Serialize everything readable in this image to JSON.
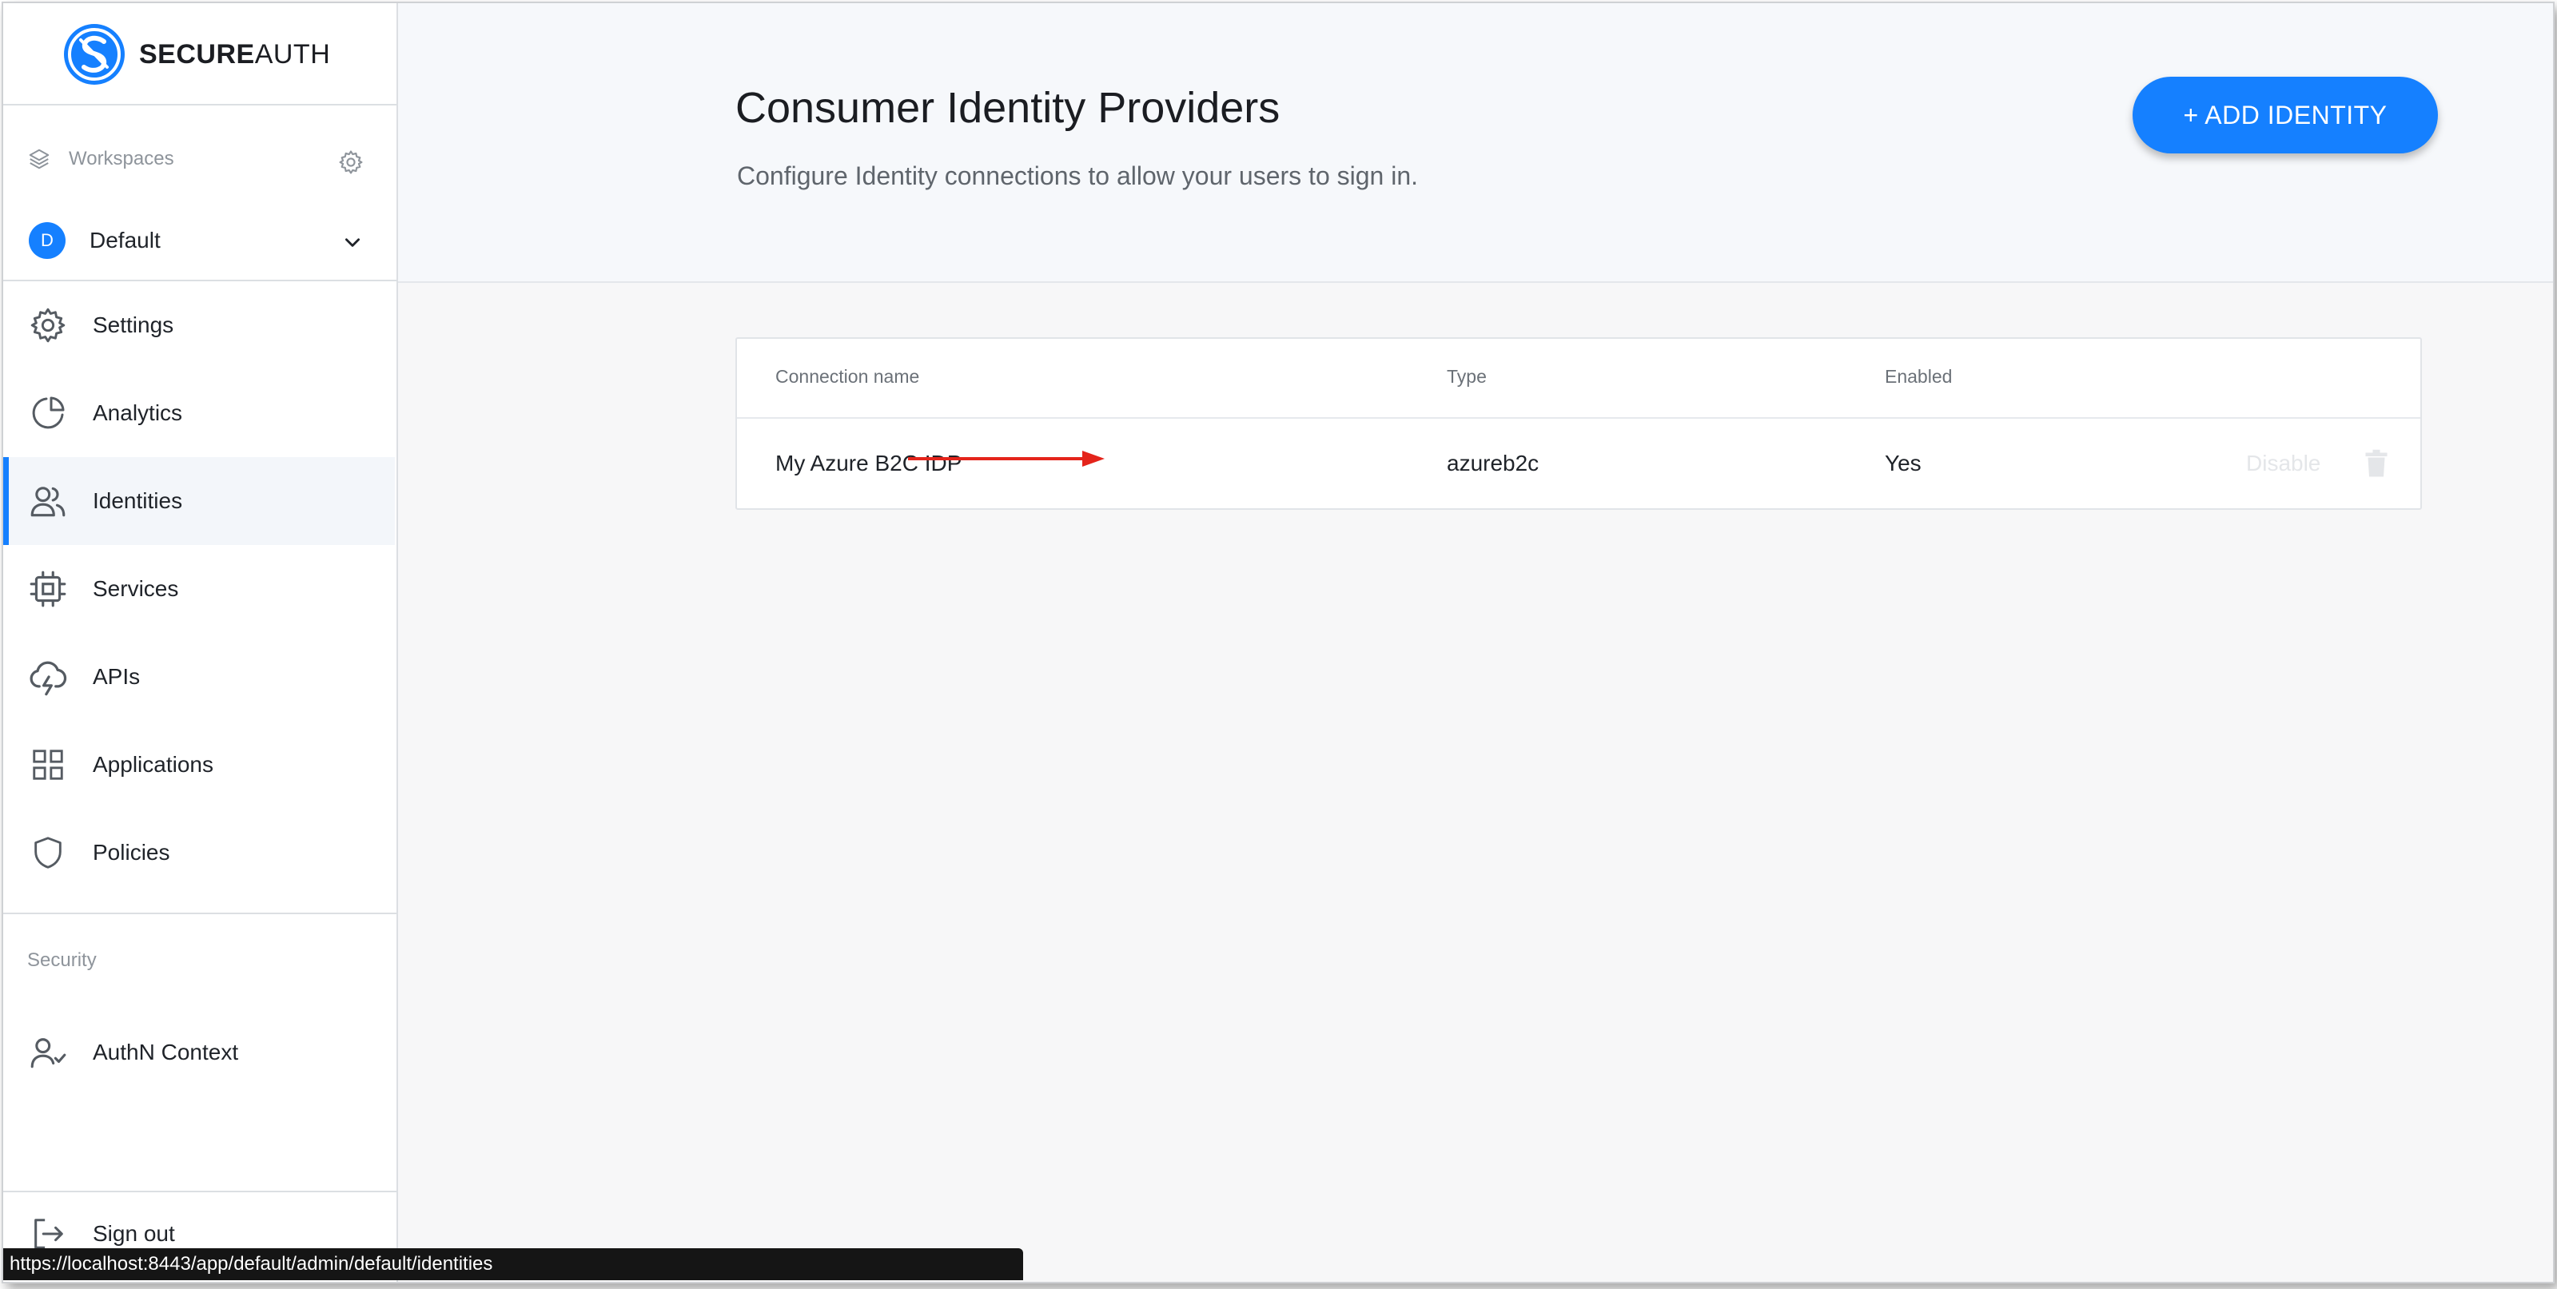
{
  "brand": {
    "bold": "SECURE",
    "light": "AUTH"
  },
  "colors": {
    "accent": "#1580ff",
    "arrow": "#e4241b"
  },
  "sidebar": {
    "workspaces_label": "Workspaces",
    "workspace": {
      "initial": "D",
      "name": "Default"
    },
    "items": [
      {
        "label": "Settings",
        "icon": "gear-icon"
      },
      {
        "label": "Analytics",
        "icon": "pie-chart-icon"
      },
      {
        "label": "Identities",
        "icon": "users-icon",
        "active": true
      },
      {
        "label": "Services",
        "icon": "chip-icon"
      },
      {
        "label": "APIs",
        "icon": "cloud-lightning-icon"
      },
      {
        "label": "Applications",
        "icon": "grid-icon"
      },
      {
        "label": "Policies",
        "icon": "shield-icon"
      }
    ],
    "security_label": "Security",
    "authn_context": "AuthN Context",
    "sign_out": "Sign out"
  },
  "header": {
    "title": "Consumer Identity Providers",
    "subtitle": "Configure Identity connections to allow your users to sign in.",
    "add_button": "+ ADD IDENTITY"
  },
  "table": {
    "columns": [
      "Connection name",
      "Type",
      "Enabled"
    ],
    "rows": [
      {
        "name": "My Azure B2C IDP",
        "type": "azureb2c",
        "enabled": "Yes",
        "action": "Disable"
      }
    ]
  },
  "status_url": "https://localhost:8443/app/default/admin/default/identities"
}
